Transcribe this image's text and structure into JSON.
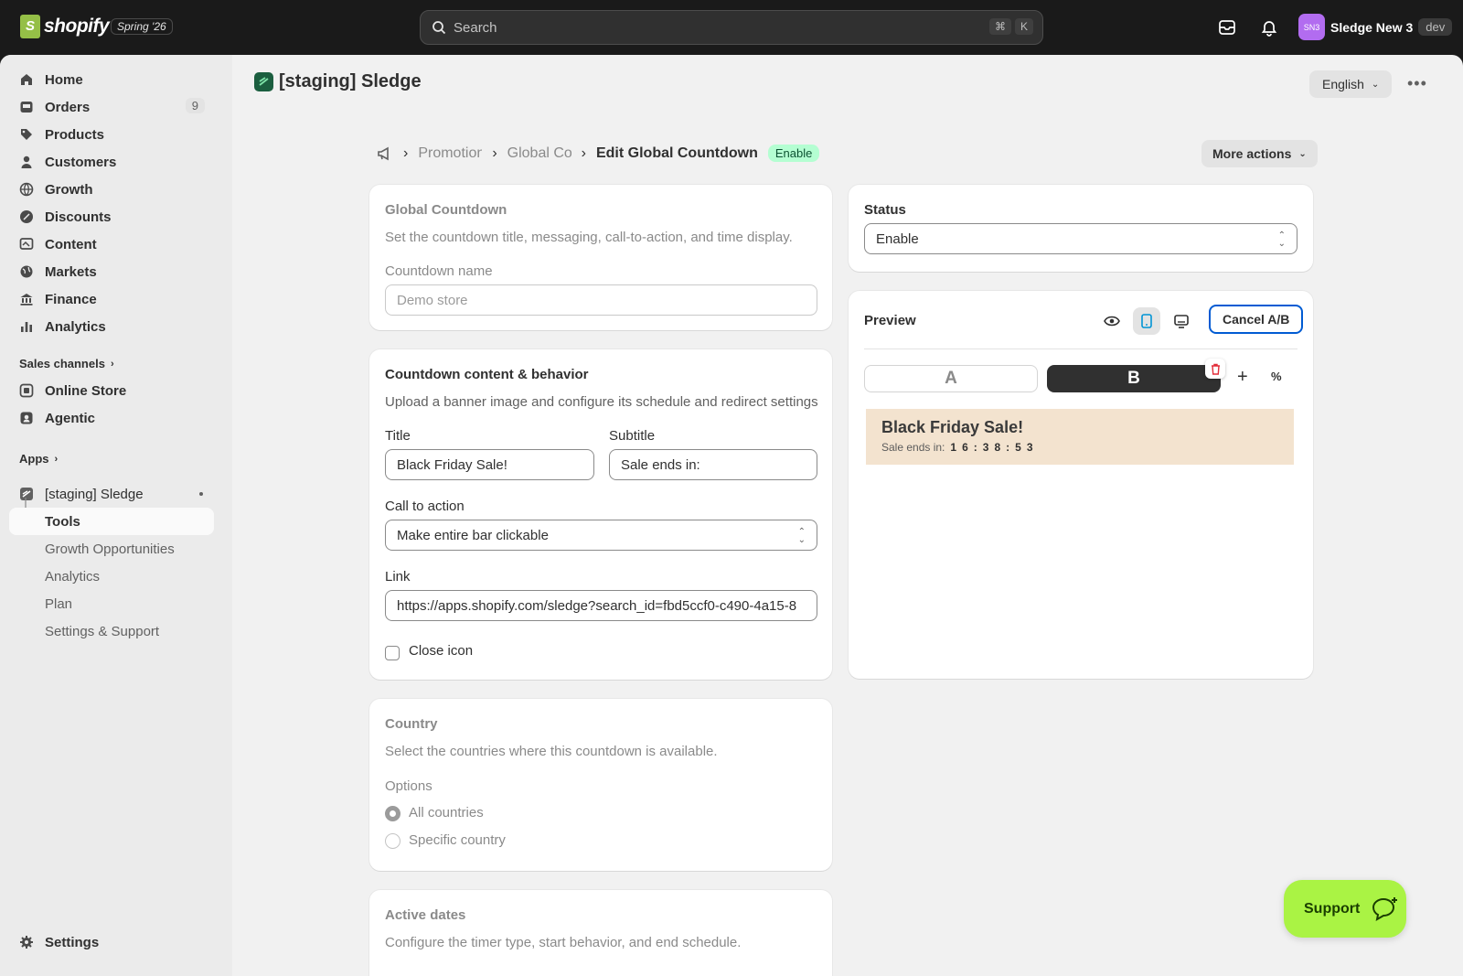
{
  "topbar": {
    "brand": "shopify",
    "edition": "Spring '26",
    "search_placeholder": "Search",
    "shortcut": [
      "⌘",
      "K"
    ],
    "store_initials": "SN3",
    "store_name": "Sledge New 3",
    "store_tag": "dev"
  },
  "sidebar": {
    "items": [
      {
        "label": "Home",
        "icon": "home-icon"
      },
      {
        "label": "Orders",
        "icon": "inbox-icon",
        "badge": "9"
      },
      {
        "label": "Products",
        "icon": "tag-icon"
      },
      {
        "label": "Customers",
        "icon": "person-icon"
      },
      {
        "label": "Growth",
        "icon": "globe-icon"
      },
      {
        "label": "Discounts",
        "icon": "discount-icon"
      },
      {
        "label": "Content",
        "icon": "content-icon"
      },
      {
        "label": "Markets",
        "icon": "markets-icon"
      },
      {
        "label": "Finance",
        "icon": "bank-icon"
      },
      {
        "label": "Analytics",
        "icon": "chart-icon"
      }
    ],
    "sales_channels_label": "Sales channels",
    "channels": [
      {
        "label": "Online Store",
        "icon": "store-icon"
      },
      {
        "label": "Agentic",
        "icon": "agentic-icon"
      }
    ],
    "apps_label": "Apps",
    "app": {
      "label": "[staging] Sledge",
      "children": [
        "Tools",
        "Growth Opportunities",
        "Analytics",
        "Plan",
        "Settings & Support"
      ],
      "active": "Tools"
    },
    "settings_label": "Settings"
  },
  "header": {
    "app_title": "[staging] Sledge",
    "language": "English"
  },
  "breadcrumb": {
    "items": [
      "Promotions",
      "Global Countdown"
    ],
    "current": "Edit Global Countdown",
    "status_badge": "Enable",
    "more_actions": "More actions"
  },
  "global_card": {
    "title": "Global Countdown",
    "description": "Set the countdown title, messaging, call-to-action, and time display.",
    "name_label": "Countdown name",
    "name_placeholder": "Demo store"
  },
  "content_card": {
    "title": "Countdown content & behavior",
    "description": "Upload a banner image and configure its schedule and redirect settings",
    "title_label": "Title",
    "title_value": "Black Friday Sale!",
    "subtitle_label": "Subtitle",
    "subtitle_value": "Sale ends in:",
    "cta_label": "Call to action",
    "cta_value": "Make entire bar clickable",
    "link_label": "Link",
    "link_value": "https://apps.shopify.com/sledge?search_id=fbd5ccf0-c490-4a15-8",
    "close_icon_label": "Close icon",
    "close_icon_checked": false
  },
  "country_card": {
    "title": "Country",
    "description": "Select the countries where this countdown is available.",
    "options_label": "Options",
    "options": [
      "All countries",
      "Specific country"
    ],
    "selected": "All countries"
  },
  "dates_card": {
    "title": "Active dates",
    "description": "Configure the timer type, start behavior, and end schedule."
  },
  "status_card": {
    "title": "Status",
    "value": "Enable"
  },
  "preview_card": {
    "title": "Preview",
    "cancel_ab": "Cancel A/B",
    "variant_a": "A",
    "variant_b": "B",
    "active_variant": "B",
    "banner_title": "Black Friday Sale!",
    "banner_subtitle": "Sale ends in:",
    "countdown_digits": [
      "1",
      "6",
      ":",
      "3",
      "8",
      ":",
      "5",
      "3"
    ]
  },
  "support_button": "Support",
  "colors": {
    "topbar": "#1a1a1a",
    "badge_success": "#b4fed2",
    "accent_focus": "#005bd3",
    "support": "#aaf344",
    "banner_bg": "#f3e3cf"
  }
}
